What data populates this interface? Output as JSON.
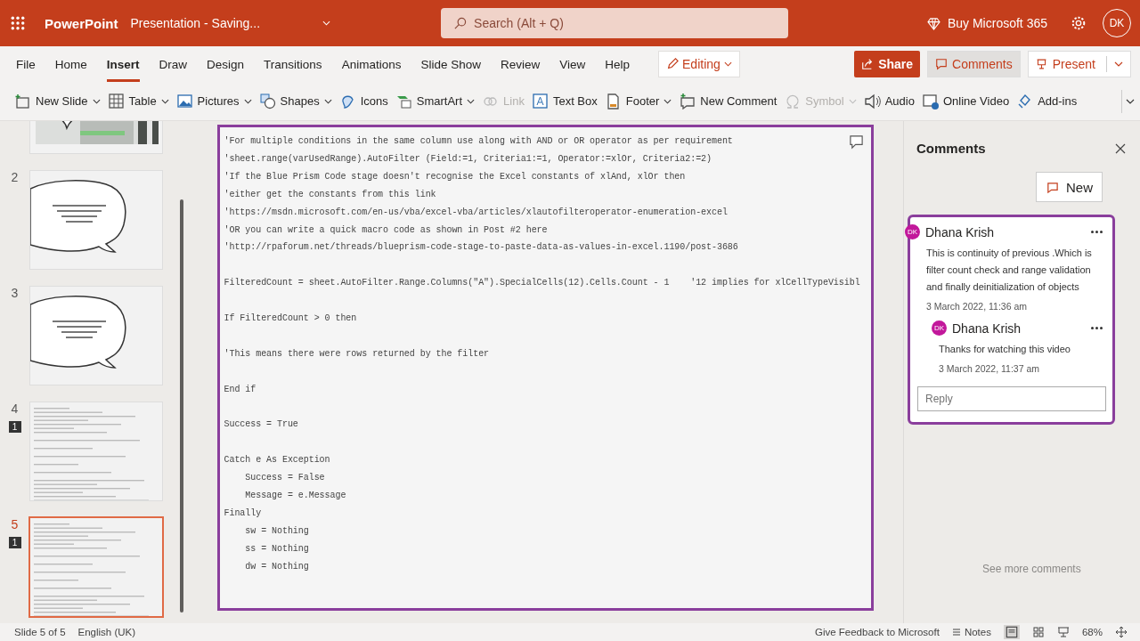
{
  "app": {
    "name": "PowerPoint",
    "document_title": "Presentation  -  Saving...",
    "search": {
      "placeholder": "Search (Alt + Q)"
    },
    "buy": "Buy Microsoft 365",
    "avatar": "DK"
  },
  "tabs": [
    {
      "label": "File",
      "selected": false
    },
    {
      "label": "Home",
      "selected": false
    },
    {
      "label": "Insert",
      "selected": true
    },
    {
      "label": "Draw",
      "selected": false
    },
    {
      "label": "Design",
      "selected": false
    },
    {
      "label": "Transitions",
      "selected": false
    },
    {
      "label": "Animations",
      "selected": false
    },
    {
      "label": "Slide Show",
      "selected": false
    },
    {
      "label": "Review",
      "selected": false
    },
    {
      "label": "View",
      "selected": false
    },
    {
      "label": "Help",
      "selected": false
    }
  ],
  "mode": {
    "label": "Editing"
  },
  "actions": {
    "share": "Share",
    "comments": {
      "label": "Comments",
      "selected": true
    },
    "present": "Present"
  },
  "ribbon": [
    {
      "label": "New Slide",
      "dropdown": true,
      "disabled": false
    },
    {
      "label": "Table",
      "dropdown": true,
      "disabled": false
    },
    {
      "label": "Pictures",
      "dropdown": true,
      "disabled": false
    },
    {
      "label": "Shapes",
      "dropdown": true,
      "disabled": false
    },
    {
      "label": "Icons",
      "dropdown": false,
      "disabled": false
    },
    {
      "label": "SmartArt",
      "dropdown": true,
      "disabled": false
    },
    {
      "label": "Link",
      "dropdown": false,
      "disabled": true
    },
    {
      "label": "Text Box",
      "dropdown": false,
      "disabled": false
    },
    {
      "label": "Footer",
      "dropdown": true,
      "disabled": false
    },
    {
      "label": "New Comment",
      "dropdown": false,
      "disabled": false
    },
    {
      "label": "Symbol",
      "dropdown": true,
      "disabled": true
    },
    {
      "label": "Audio",
      "dropdown": false,
      "disabled": false
    },
    {
      "label": "Online Video",
      "dropdown": false,
      "disabled": false
    },
    {
      "label": "Add-ins",
      "dropdown": false,
      "disabled": false
    }
  ],
  "thumbnails": [
    {
      "kind": "photo-bubble",
      "selected": false
    },
    {
      "number": "2",
      "kind": "bubble",
      "selected": false
    },
    {
      "number": "3",
      "kind": "bubble",
      "selected": false
    },
    {
      "number": "4",
      "kind": "code",
      "comments": "1",
      "selected": false
    },
    {
      "number": "5",
      "kind": "code",
      "comments": "1",
      "selected": true
    }
  ],
  "slide": {
    "code_blocks": [
      [
        "'For multiple conditions in the same column use along with AND or OR operator as per requirement",
        "'sheet.range(varUsedRange).AutoFilter (Field:=1, Criteria1:=1, Operator:=xlOr, Criteria2:=2)",
        "'If the Blue Prism Code stage doesn't recognise the Excel constants of xlAnd, xlOr then",
        "'either get the constants from this link",
        "'https://msdn.microsoft.com/en-us/vba/excel-vba/articles/xlautofilteroperator-enumeration-excel",
        "'OR you can write a quick macro code as shown in Post #2 here",
        "'http://rpaforum.net/threads/blueprism-code-stage-to-paste-data-as-values-in-excel.1190/post-3686"
      ],
      [
        "FilteredCount = sheet.AutoFilter.Range.Columns(\"A\").SpecialCells(12).Cells.Count - 1    '12 implies for xlCellTypeVisibl"
      ],
      [
        "If FilteredCount > 0 then"
      ],
      [
        "'This means there were rows returned by the filter"
      ],
      [
        "End if"
      ],
      [
        "Success = True"
      ],
      [
        "Catch e As Exception",
        "    Success = False",
        "    Message = e.Message",
        "Finally",
        "    sw = Nothing",
        "    ss = Nothing",
        "    dw = Nothing"
      ]
    ]
  },
  "comments_pane": {
    "title": "Comments",
    "new_button": "New",
    "thread": {
      "author": "Dhana Krish",
      "initials": "DK",
      "text": "This is continuity of previous .Which is filter count check and range validation and finally deinitialization of objects",
      "time": "3 March 2022, 11:36 am",
      "replies": [
        {
          "author": "Dhana Krish",
          "initials": "DK",
          "text": "Thanks for watching this video",
          "time": "3 March 2022, 11:37 am"
        }
      ],
      "reply_placeholder": "Reply"
    },
    "see_more": "See more comments"
  },
  "status_bar": {
    "slide": "Slide 5 of 5",
    "language": "English (UK)",
    "feedback": "Give Feedback to Microsoft",
    "notes": "Notes",
    "zoom": "68%"
  }
}
